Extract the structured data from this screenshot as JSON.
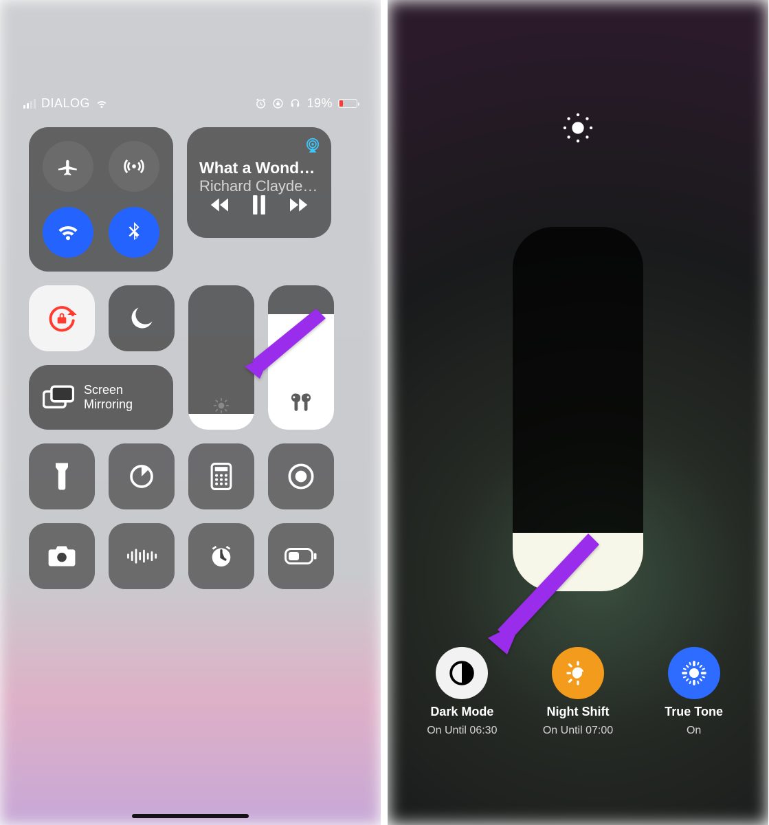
{
  "left": {
    "status": {
      "carrier": "DIALOG",
      "battery_pct": "19%",
      "signal_bars": 2
    },
    "media": {
      "title": "What a Wonderf…",
      "artist": "Richard Clayderman…"
    },
    "mirror_label_l1": "Screen",
    "mirror_label_l2": "Mirroring",
    "brightness_pct": 11,
    "volume_pct": 80
  },
  "right": {
    "brightness_pct": 16,
    "options": [
      {
        "title": "Dark Mode",
        "sub": "On Until 06:30",
        "color": "white",
        "icon": "darkmode"
      },
      {
        "title": "Night Shift",
        "sub": "On Until 07:00",
        "color": "orange",
        "icon": "nightshift"
      },
      {
        "title": "True Tone",
        "sub": "On",
        "color": "blue",
        "icon": "truetone"
      }
    ]
  },
  "colors": {
    "accent_blue": "#2563ff",
    "danger_red": "#ff3b30",
    "annotation_purple": "#9a2deb"
  }
}
